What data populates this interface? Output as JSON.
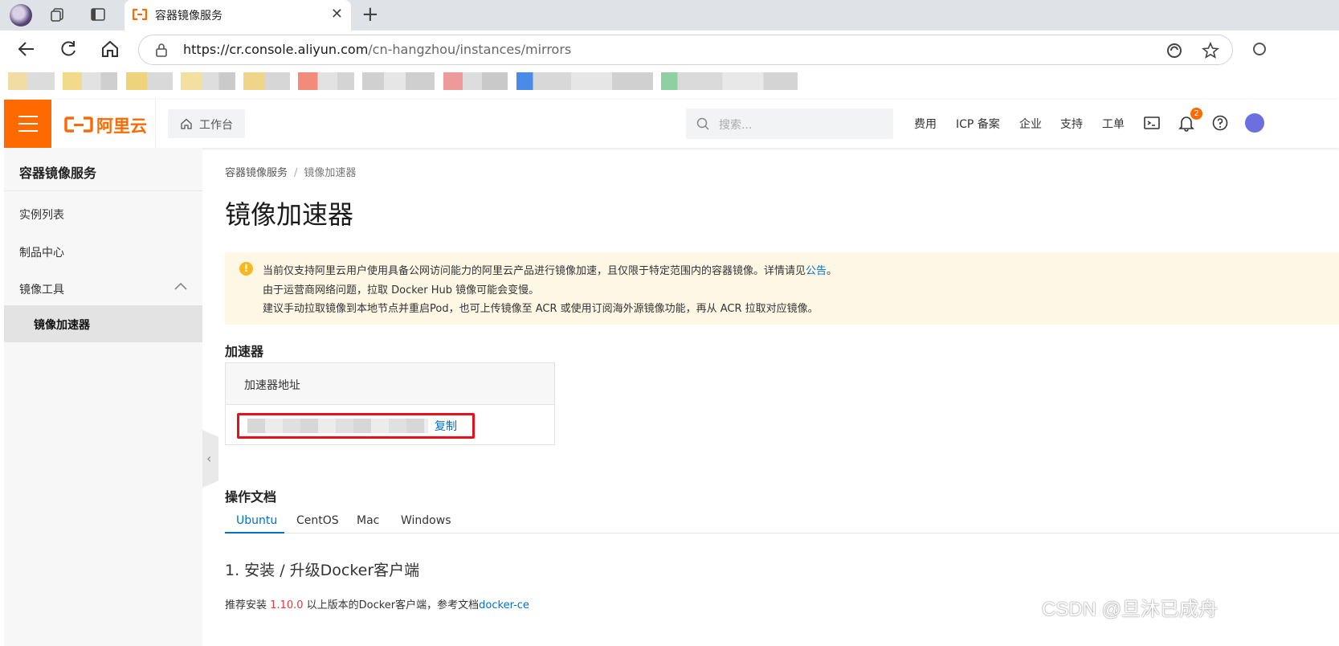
{
  "browser": {
    "tab_title": "容器镜像服务",
    "url_domain": "https://cr.console.aliyun.com",
    "url_path": "/cn-hangzhou/instances/mirrors"
  },
  "header": {
    "brand": "阿里云",
    "workbench": "工作台",
    "search_placeholder": "搜索...",
    "links": [
      "费用",
      "ICP 备案",
      "企业",
      "支持",
      "工单"
    ],
    "notification_count": "2"
  },
  "sidebar": {
    "title": "容器镜像服务",
    "items": [
      "实例列表",
      "制品中心",
      "镜像工具"
    ],
    "sub_item": "镜像加速器"
  },
  "main": {
    "breadcrumb": [
      "容器镜像服务",
      "镜像加速器"
    ],
    "breadcrumb_sep": "/",
    "title": "镜像加速器",
    "alert": {
      "line1_pre": "当前仅支持阿里云用户使用具备公网访问能力的阿里云产品进行镜像加速，且仅限于特定范围内的容器镜像。详情请见",
      "line1_link": "公告",
      "line1_post": "。",
      "line2": "由于运营商网络问题，拉取 Docker Hub 镜像可能会变慢。",
      "line3": "建议手动拉取镜像到本地节点并重启Pod，也可上传镜像至 ACR 或使用订阅海外源镜像功能，再从 ACR 拉取对应镜像。"
    },
    "accelerator": {
      "section_title": "加速器",
      "column_header": "加速器地址",
      "copy_label": "复制"
    },
    "docs": {
      "section_title": "操作文档",
      "tabs": [
        "Ubuntu",
        "CentOS",
        "Mac",
        "Windows"
      ],
      "active_tab": "Ubuntu",
      "step_title": "1. 安装 / 升级Docker客户端",
      "step_text_pre": "推荐安装 ",
      "step_version": "1.10.0",
      "step_text_mid": " 以上版本的Docker客户端，参考文档",
      "step_link": "docker-ce"
    }
  },
  "watermark": "CSDN @旦沐已成舟",
  "colors": {
    "brand_orange": "#ff6a00",
    "link_blue": "#0070cc",
    "alert_bg": "#fff7e6",
    "highlight_red": "#e8101a"
  }
}
